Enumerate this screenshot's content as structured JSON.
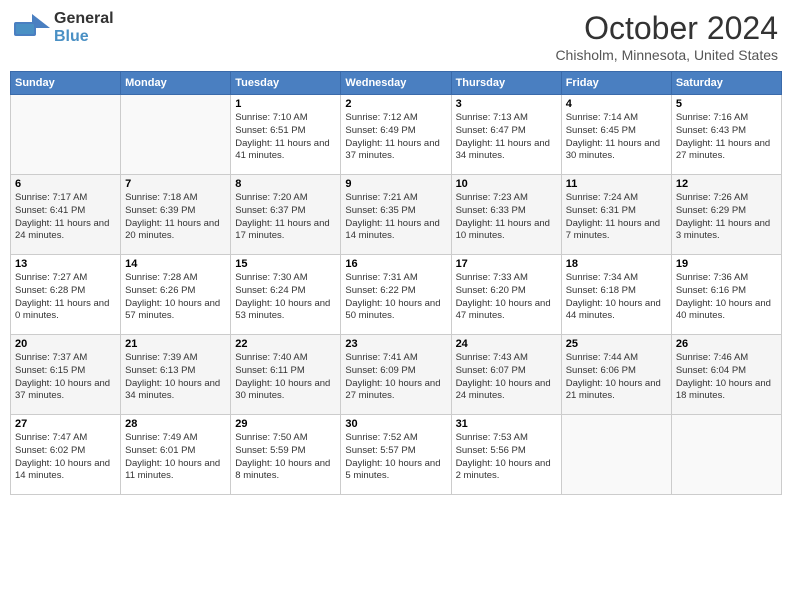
{
  "header": {
    "logo": {
      "general": "General",
      "blue": "Blue"
    },
    "title": "October 2024",
    "location": "Chisholm, Minnesota, United States"
  },
  "weekdays": [
    "Sunday",
    "Monday",
    "Tuesday",
    "Wednesday",
    "Thursday",
    "Friday",
    "Saturday"
  ],
  "weeks": [
    [
      {
        "day": "",
        "info": ""
      },
      {
        "day": "",
        "info": ""
      },
      {
        "day": "1",
        "info": "Sunrise: 7:10 AM\nSunset: 6:51 PM\nDaylight: 11 hours and 41 minutes."
      },
      {
        "day": "2",
        "info": "Sunrise: 7:12 AM\nSunset: 6:49 PM\nDaylight: 11 hours and 37 minutes."
      },
      {
        "day": "3",
        "info": "Sunrise: 7:13 AM\nSunset: 6:47 PM\nDaylight: 11 hours and 34 minutes."
      },
      {
        "day": "4",
        "info": "Sunrise: 7:14 AM\nSunset: 6:45 PM\nDaylight: 11 hours and 30 minutes."
      },
      {
        "day": "5",
        "info": "Sunrise: 7:16 AM\nSunset: 6:43 PM\nDaylight: 11 hours and 27 minutes."
      }
    ],
    [
      {
        "day": "6",
        "info": "Sunrise: 7:17 AM\nSunset: 6:41 PM\nDaylight: 11 hours and 24 minutes."
      },
      {
        "day": "7",
        "info": "Sunrise: 7:18 AM\nSunset: 6:39 PM\nDaylight: 11 hours and 20 minutes."
      },
      {
        "day": "8",
        "info": "Sunrise: 7:20 AM\nSunset: 6:37 PM\nDaylight: 11 hours and 17 minutes."
      },
      {
        "day": "9",
        "info": "Sunrise: 7:21 AM\nSunset: 6:35 PM\nDaylight: 11 hours and 14 minutes."
      },
      {
        "day": "10",
        "info": "Sunrise: 7:23 AM\nSunset: 6:33 PM\nDaylight: 11 hours and 10 minutes."
      },
      {
        "day": "11",
        "info": "Sunrise: 7:24 AM\nSunset: 6:31 PM\nDaylight: 11 hours and 7 minutes."
      },
      {
        "day": "12",
        "info": "Sunrise: 7:26 AM\nSunset: 6:29 PM\nDaylight: 11 hours and 3 minutes."
      }
    ],
    [
      {
        "day": "13",
        "info": "Sunrise: 7:27 AM\nSunset: 6:28 PM\nDaylight: 11 hours and 0 minutes."
      },
      {
        "day": "14",
        "info": "Sunrise: 7:28 AM\nSunset: 6:26 PM\nDaylight: 10 hours and 57 minutes."
      },
      {
        "day": "15",
        "info": "Sunrise: 7:30 AM\nSunset: 6:24 PM\nDaylight: 10 hours and 53 minutes."
      },
      {
        "day": "16",
        "info": "Sunrise: 7:31 AM\nSunset: 6:22 PM\nDaylight: 10 hours and 50 minutes."
      },
      {
        "day": "17",
        "info": "Sunrise: 7:33 AM\nSunset: 6:20 PM\nDaylight: 10 hours and 47 minutes."
      },
      {
        "day": "18",
        "info": "Sunrise: 7:34 AM\nSunset: 6:18 PM\nDaylight: 10 hours and 44 minutes."
      },
      {
        "day": "19",
        "info": "Sunrise: 7:36 AM\nSunset: 6:16 PM\nDaylight: 10 hours and 40 minutes."
      }
    ],
    [
      {
        "day": "20",
        "info": "Sunrise: 7:37 AM\nSunset: 6:15 PM\nDaylight: 10 hours and 37 minutes."
      },
      {
        "day": "21",
        "info": "Sunrise: 7:39 AM\nSunset: 6:13 PM\nDaylight: 10 hours and 34 minutes."
      },
      {
        "day": "22",
        "info": "Sunrise: 7:40 AM\nSunset: 6:11 PM\nDaylight: 10 hours and 30 minutes."
      },
      {
        "day": "23",
        "info": "Sunrise: 7:41 AM\nSunset: 6:09 PM\nDaylight: 10 hours and 27 minutes."
      },
      {
        "day": "24",
        "info": "Sunrise: 7:43 AM\nSunset: 6:07 PM\nDaylight: 10 hours and 24 minutes."
      },
      {
        "day": "25",
        "info": "Sunrise: 7:44 AM\nSunset: 6:06 PM\nDaylight: 10 hours and 21 minutes."
      },
      {
        "day": "26",
        "info": "Sunrise: 7:46 AM\nSunset: 6:04 PM\nDaylight: 10 hours and 18 minutes."
      }
    ],
    [
      {
        "day": "27",
        "info": "Sunrise: 7:47 AM\nSunset: 6:02 PM\nDaylight: 10 hours and 14 minutes."
      },
      {
        "day": "28",
        "info": "Sunrise: 7:49 AM\nSunset: 6:01 PM\nDaylight: 10 hours and 11 minutes."
      },
      {
        "day": "29",
        "info": "Sunrise: 7:50 AM\nSunset: 5:59 PM\nDaylight: 10 hours and 8 minutes."
      },
      {
        "day": "30",
        "info": "Sunrise: 7:52 AM\nSunset: 5:57 PM\nDaylight: 10 hours and 5 minutes."
      },
      {
        "day": "31",
        "info": "Sunrise: 7:53 AM\nSunset: 5:56 PM\nDaylight: 10 hours and 2 minutes."
      },
      {
        "day": "",
        "info": ""
      },
      {
        "day": "",
        "info": ""
      }
    ]
  ]
}
